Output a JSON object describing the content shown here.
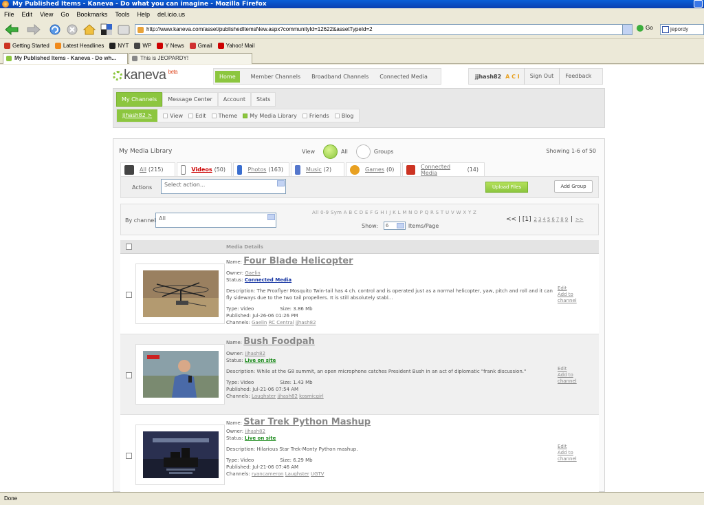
{
  "window": {
    "title": "My Published Items - Kaneva - Do what you can imagine - Mozilla Firefox"
  },
  "menu": [
    "File",
    "Edit",
    "View",
    "Go",
    "Bookmarks",
    "Tools",
    "Help",
    "del.icio.us"
  ],
  "toolbar": {
    "url": "http://www.kaneva.com/asset/publishedItemsNew.aspx?communityId=12622&assetTypeId=2",
    "go_label": "Go",
    "search_value": "jepordy"
  },
  "bookmarks": [
    {
      "label": "Getting Started",
      "color": "#cc3322"
    },
    {
      "label": "Latest Headlines",
      "color": "#f08a1c"
    },
    {
      "label": "NYT",
      "color": "#222222"
    },
    {
      "label": "WP",
      "color": "#444444"
    },
    {
      "label": "Y News",
      "color": "#cc0000"
    },
    {
      "label": "Gmail",
      "color": "#d03030"
    },
    {
      "label": "Yahoo! Mail",
      "color": "#cc0000"
    }
  ],
  "tabs": [
    {
      "label": "My Published Items - Kaneva - Do wh..."
    },
    {
      "label": "This is JEOPARDY!"
    }
  ],
  "status": "Done",
  "site": {
    "logo": "kaneva",
    "beta": "beta",
    "nav": [
      "Home",
      "Member Channels",
      "Broadband Channels",
      "Connected Media"
    ],
    "user": {
      "name": "jjhash82",
      "aci": "A C I",
      "sign_out": "Sign Out",
      "feedback": "Feedback"
    },
    "channel_tabs": [
      "My Channels",
      "Message Center",
      "Account",
      "Stats"
    ],
    "sub_user": "jjhash82 >",
    "sub_tabs": [
      "View",
      "Edit",
      "Theme",
      "My Media Library",
      "Friends",
      "Blog"
    ]
  },
  "library": {
    "title": "My Media Library",
    "view_label": "View",
    "view_all": "All",
    "view_groups": "Groups",
    "showing": "Showing 1-6 of 50",
    "type_tabs": [
      {
        "label": "All",
        "count": "(215)",
        "color": "#444"
      },
      {
        "label": "Videos",
        "count": "(50)",
        "color": "#888"
      },
      {
        "label": "Photos",
        "count": "(163)",
        "color": "#3a6ecf"
      },
      {
        "label": "Music",
        "count": "(2)",
        "color": "#5577cc"
      },
      {
        "label": "Games",
        "count": "(0)",
        "color": "#e8a020"
      },
      {
        "label": "Connected Media",
        "count": "(14)",
        "color": "#cc3322"
      }
    ],
    "actions_label": "Actions",
    "actions_placeholder": "Select action...",
    "upload_label": "Upload Files",
    "add_group_label": "Add Group",
    "by_channel_label": "By channel:",
    "by_channel_value": "All",
    "letters": "All 0-9 Sym A B C D E F G H I J K L M N O P Q R S T U V W X Y Z",
    "show_label": "Show:",
    "show_value": "6",
    "items_per_page": "Items/Page",
    "pager_prev": "<<",
    "pager_current": "[1]",
    "pages": [
      "2",
      "3",
      "4",
      "5",
      "6",
      "7",
      "8",
      "9"
    ],
    "pager_next": ">>",
    "media_details_label": "Media Details",
    "labels": {
      "name": "Name:",
      "owner": "Owner:",
      "status": "Status:",
      "description": "Description:",
      "type": "Type:",
      "size": "Size:",
      "published": "Published:",
      "channels": "Channels:"
    },
    "row_actions": [
      "Edit",
      "Add to",
      "channel"
    ],
    "items": [
      {
        "name": "Four Blade Helicopter",
        "owner": "Gaelin",
        "status": "Connected Media",
        "description": "The Proxflyer Mosquito Twin-tail has 4 ch. control and is operated just as a normal helicopter, yaw, pitch and roll and it can fly sideways due to the two tail propellers. It is still absolutely stabl...",
        "type": "Video",
        "size": "3.86 Mb",
        "published": "Jul-26-06 01:26 PM",
        "channels": [
          "Gaelin",
          "RC Central",
          "jjhash82"
        ]
      },
      {
        "name": "Bush Foodpah",
        "owner": "jjhash82",
        "status": "Live on site",
        "description": "While at the G8 summit, an open microphone catches President Bush in an act of diplomatic \"frank discussion.\"",
        "type": "Video",
        "size": "1.43 Mb",
        "published": "Jul-21-06 07:54 AM",
        "channels": [
          "Laughster",
          "jjhash82",
          "kosmicgirl"
        ]
      },
      {
        "name": "Star Trek Python Mashup",
        "owner": "jjhash82",
        "status": "Live on site",
        "description": "Hilarious Star Trek-Monty Python mashup.",
        "type": "Video",
        "size": "6.29 Mb",
        "published": "Jul-21-06 07:46 AM",
        "channels": [
          "ryancameron",
          "Laughster",
          "UGTV"
        ]
      }
    ]
  }
}
